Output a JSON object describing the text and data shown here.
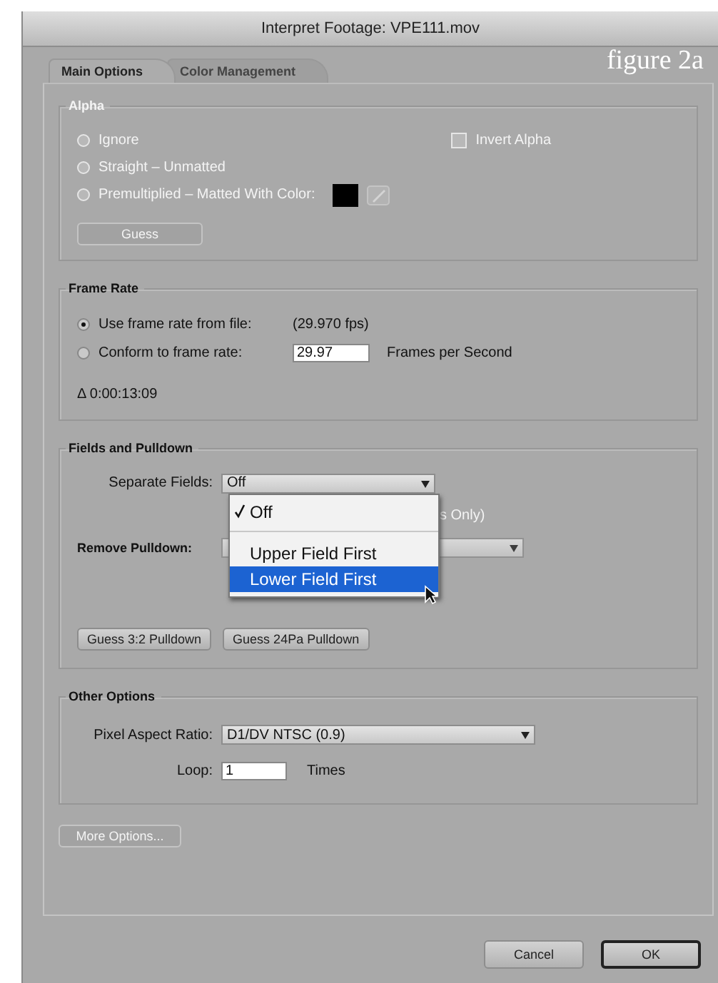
{
  "window": {
    "title": "Interpret Footage: VPE111.mov"
  },
  "figure_label": "figure 2a",
  "tabs": [
    {
      "label": "Main Options",
      "selected": true
    },
    {
      "label": "Color Management",
      "selected": false
    }
  ],
  "alpha": {
    "title": "Alpha",
    "disabled": true,
    "options": [
      {
        "label": "Ignore",
        "selected": false
      },
      {
        "label": "Straight – Unmatted",
        "selected": false
      },
      {
        "label": "Premultiplied – Matted With Color:",
        "selected": false
      }
    ],
    "invert": {
      "label": "Invert Alpha",
      "checked": false
    },
    "guess_button": "Guess"
  },
  "frame_rate": {
    "title": "Frame Rate",
    "options": [
      {
        "kind": "reading",
        "label": "Use frame rate from file:",
        "selected": true,
        "value": "(29.970 fps)"
      },
      {
        "kind": "input",
        "label": "Conform to frame rate:",
        "selected": false,
        "value": "29.97",
        "unit": "Frames per Second"
      }
    ],
    "duration": "Δ 0:00:13:09"
  },
  "fields": {
    "title": "Fields and Pulldown",
    "separate_label": "Separate Fields:",
    "separate_value": "Off",
    "menu": [
      {
        "label": "Off",
        "checked": true,
        "selected": false
      },
      {
        "label": "Upper Field First",
        "checked": false,
        "selected": false
      },
      {
        "label": "Lower Field First",
        "checked": false,
        "selected": true
      }
    ],
    "hidden_note": "s Only)",
    "remove_label": "Remove Pulldown:",
    "buttons": [
      "Guess 3:2 Pulldown",
      "Guess 24Pa Pulldown"
    ]
  },
  "other": {
    "title": "Other Options",
    "par_label": "Pixel Aspect Ratio:",
    "par_value": "D1/DV NTSC (0.9)",
    "loop_label": "Loop:",
    "loop_value": "1",
    "loop_unit": "Times"
  },
  "more_button": {
    "label": "More Options...",
    "disabled": true
  },
  "buttons": [
    {
      "label": "Cancel",
      "default": false
    },
    {
      "label": "OK",
      "default": true
    }
  ]
}
